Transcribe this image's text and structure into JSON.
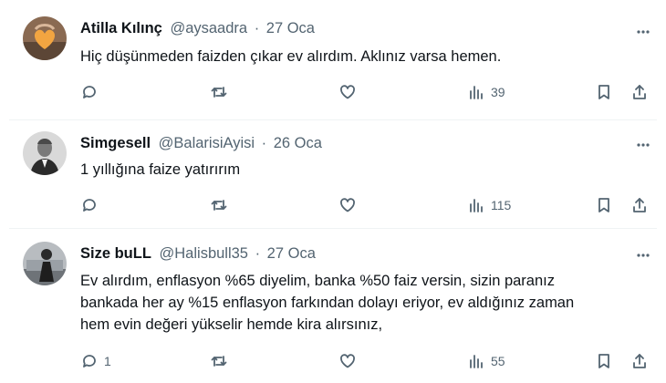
{
  "tweets": [
    {
      "name": "Atilla Kılınç",
      "handle": "@aysaadra",
      "separator": "·",
      "date": "27 Oca",
      "lines": [
        "Hiç düşünmeden faizden çıkar ev alırdım. Aklınız varsa hemen."
      ],
      "replies": "",
      "views": "39"
    },
    {
      "name": "Simgesell",
      "handle": "@BalarisiAyisi",
      "separator": "·",
      "date": "26 Oca",
      "lines": [
        "1 yıllığına faize yatırırım"
      ],
      "replies": "",
      "views": "115"
    },
    {
      "name": "Size buLL",
      "handle": "@Halisbull35",
      "separator": "·",
      "date": "27 Oca",
      "lines": [
        "Ev alırdım, enflasyon %65 diyelim, banka %50 faiz versin, sizin paranız",
        "bankada her ay %15 enflasyon farkından dolayı eriyor, ev aldığınız zaman",
        "hem evin değeri yükselir hemde kira alırsınız,"
      ],
      "replies": "1",
      "views": "55"
    }
  ],
  "icons": {
    "reply": "speech-bubble-icon",
    "retweet": "retweet-icon",
    "like": "heart-icon",
    "views": "bar-chart-icon",
    "bookmark": "bookmark-icon",
    "share": "share-icon",
    "more": "more-dots-icon"
  },
  "colors": {
    "text": "#0f1419",
    "secondary": "#536471",
    "divider": "#eff3f4"
  }
}
